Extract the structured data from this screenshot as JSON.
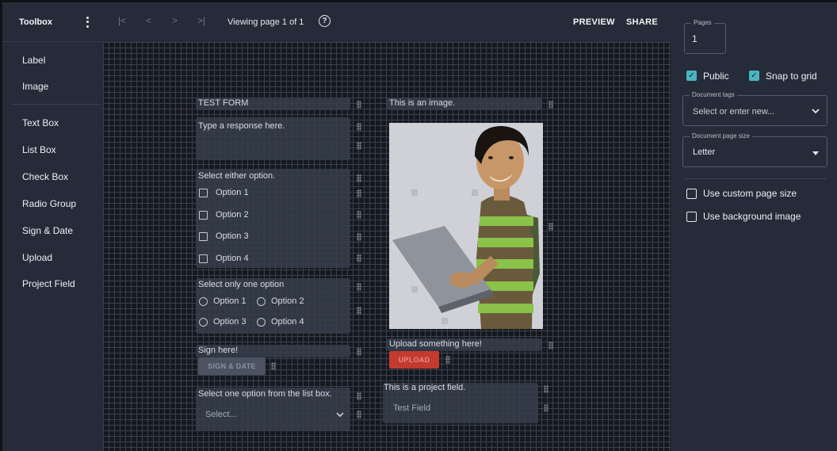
{
  "sidebar": {
    "title": "Toolbox",
    "items": [
      {
        "label": "Label"
      },
      {
        "label": "Image"
      },
      {
        "label": "Text Box"
      },
      {
        "label": "List Box"
      },
      {
        "label": "Check Box"
      },
      {
        "label": "Radio Group"
      },
      {
        "label": "Sign & Date"
      },
      {
        "label": "Upload"
      },
      {
        "label": "Project Field"
      }
    ]
  },
  "topbar": {
    "first_glyph": "|<",
    "prev_glyph": "<",
    "next_glyph": ">",
    "last_glyph": ">|",
    "page_info": "Viewing page 1 of 1",
    "help_glyph": "?",
    "preview_label": "PREVIEW",
    "share_label": "SHARE"
  },
  "form": {
    "title": "TEST FORM",
    "text_box_label": "Type a response here.",
    "checkbox_group": {
      "label": "Select either option.",
      "options": [
        "Option 1",
        "Option 2",
        "Option 3",
        "Option 4"
      ]
    },
    "radio_group": {
      "label": "Select only one option",
      "options": [
        "Option 1",
        "Option 2",
        "Option 3",
        "Option 4"
      ]
    },
    "sign": {
      "label": "Sign here!",
      "button": "SIGN & DATE"
    },
    "list_box": {
      "label": "Select one option from the list box.",
      "placeholder": "Select..."
    },
    "image_label": "This is an image.",
    "upload": {
      "label": "Upload something here!",
      "button": "UPLOAD"
    },
    "project_field": {
      "label": "This is a project field.",
      "value": "Test Field"
    }
  },
  "panel": {
    "pages_label": "Pages",
    "pages_value": "1",
    "public_label": "Public",
    "public_checked": true,
    "snap_label": "Snap to grid",
    "snap_checked": true,
    "tags_label": "Document tags",
    "tags_placeholder": "Select or enter new...",
    "page_size_label": "Document page size",
    "page_size_value": "Letter",
    "custom_size_label": "Use custom page size",
    "custom_size_checked": false,
    "bg_image_label": "Use background image",
    "bg_image_checked": false
  },
  "colors": {
    "accent": "#4bb5c1",
    "upload_red": "#c23b2e",
    "panel_bg": "#252b38",
    "canvas_bg": "#15191f"
  }
}
